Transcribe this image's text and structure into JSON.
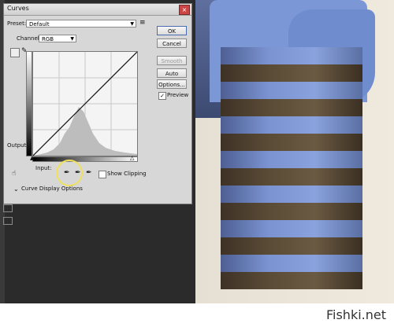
{
  "dialog": {
    "title": "Curves",
    "preset_label": "Preset:",
    "preset_value": "Default",
    "channel_label": "Channel:",
    "channel_value": "RGB",
    "output_label": "Output:",
    "input_label": "Input:",
    "show_clipping": "Show Clipping",
    "curve_display_options": "Curve Display Options",
    "buttons": {
      "ok": "OK",
      "cancel": "Cancel",
      "smooth": "Smooth",
      "auto": "Auto",
      "options": "Options..."
    },
    "preview_label": "Preview"
  },
  "footer": {
    "watermark": "Fishki.net"
  }
}
